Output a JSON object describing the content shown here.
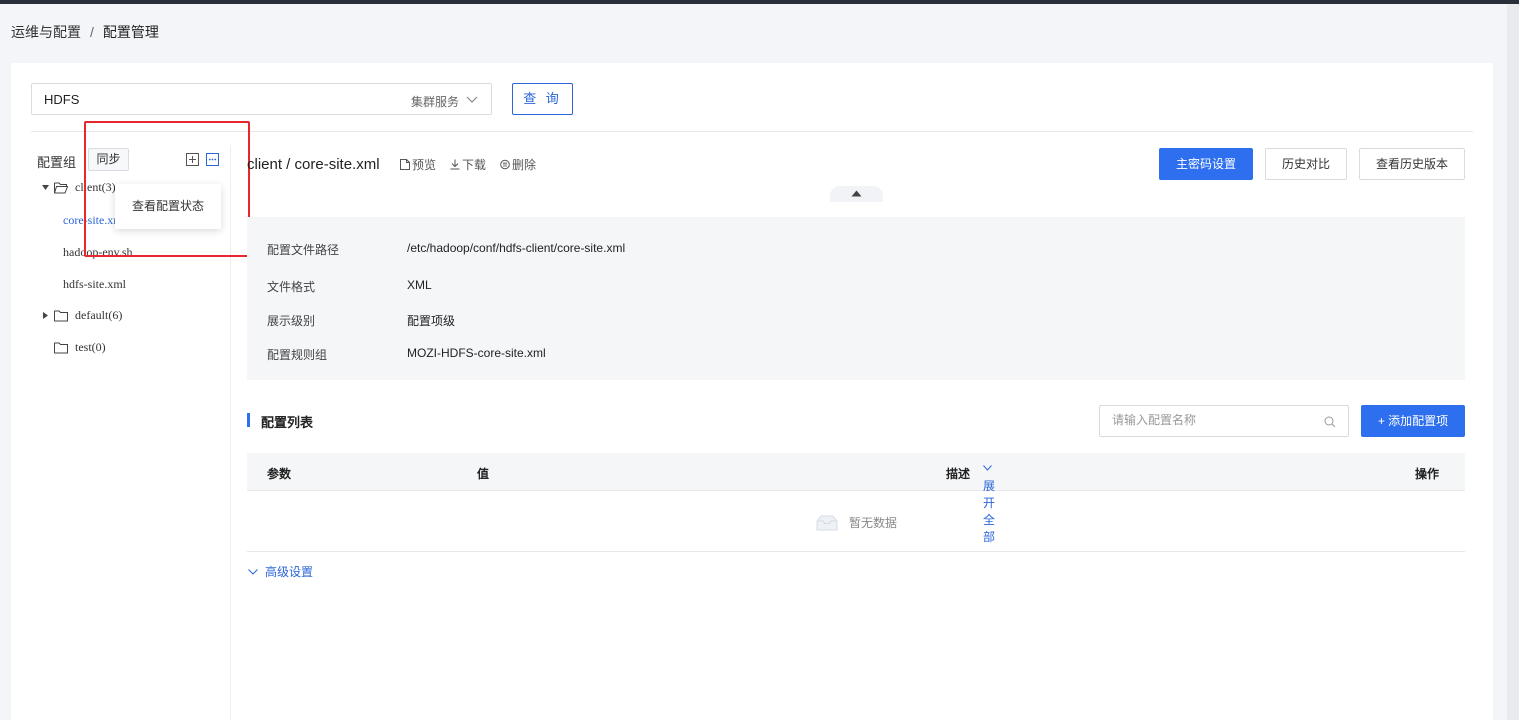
{
  "breadcrumb": {
    "parent": "运维与配置",
    "separator": "/",
    "current": "配置管理"
  },
  "service_select": {
    "value": "HDFS",
    "tag": "集群服务"
  },
  "query_button": "查 询",
  "config_group": {
    "label": "配置组",
    "sync_button": "同步",
    "popup_item": "查看配置状态",
    "tree": [
      {
        "label": "client(3)",
        "expanded": true,
        "children": [
          "core-site.xml",
          "hadoop-env.sh",
          "hdfs-site.xml"
        ]
      },
      {
        "label": "default(6)",
        "expanded": false
      },
      {
        "label": "test(0)",
        "expanded": false
      }
    ]
  },
  "file": {
    "title": "client / core-site.xml",
    "actions": {
      "preview": "预览",
      "download": "下载",
      "delete": "删除"
    }
  },
  "buttons": {
    "master_key": "主密码设置",
    "history_compare": "历史对比",
    "view_history": "查看历史版本"
  },
  "info": [
    {
      "label": "配置文件路径",
      "value": "/etc/hadoop/conf/hdfs-client/core-site.xml"
    },
    {
      "label": "文件格式",
      "value": "XML"
    },
    {
      "label": "展示级别",
      "value": "配置项级"
    },
    {
      "label": "配置规则组",
      "value": "MOZI-HDFS-core-site.xml"
    }
  ],
  "config_list": {
    "title": "配置列表",
    "search_placeholder": "请输入配置名称",
    "add_button": "+ 添加配置项",
    "columns": {
      "param": "参数",
      "value": "值",
      "desc": "描述",
      "expand_all": "展开全部",
      "ops": "操作"
    },
    "empty_text": "暂无数据"
  },
  "advanced": "高级设置",
  "colors": {
    "primary": "#2e6ff0",
    "link": "#2b65d9",
    "highlight": "#e8262e"
  }
}
